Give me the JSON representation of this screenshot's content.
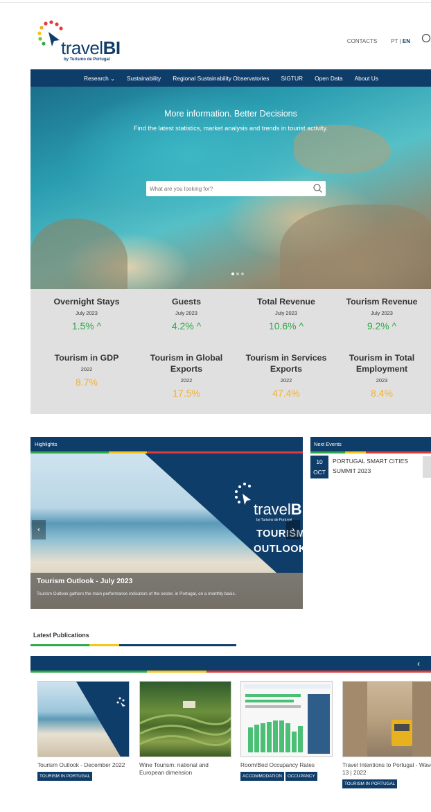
{
  "header": {
    "logo_word_light": "travel",
    "logo_word_bold": "BI",
    "logo_sub": "by Turismo de Portugal",
    "contacts": "CONTACTS",
    "lang_pt": "PT",
    "lang_sep": " | ",
    "lang_en": "EN"
  },
  "nav": {
    "items": [
      "Research",
      "Sustainability",
      "Regional Sustainability Observatories",
      "SIGTUR",
      "Open Data",
      "About Us"
    ],
    "caret": "⌄"
  },
  "hero": {
    "headline": "More information. Better Decisions",
    "tagline": "Find the latest statistics, market analysis and trends in tourist activity.",
    "search_placeholder": "What are you looking for?"
  },
  "kpis": [
    {
      "title": "Overnight Stays",
      "date": "July 2023",
      "value": "1.5% ^",
      "trend": "up"
    },
    {
      "title": "Guests",
      "date": "July 2023",
      "value": "4.2% ^",
      "trend": "up"
    },
    {
      "title": "Total Revenue",
      "date": "July 2023",
      "value": "10.6% ^",
      "trend": "up"
    },
    {
      "title": "Tourism Revenue",
      "date": "July 2023",
      "value": "9.2% ^",
      "trend": "up"
    },
    {
      "title": "Tourism in GDP",
      "date": "2022",
      "value": "8.7%",
      "trend": "none"
    },
    {
      "title": "Tourism in Global Exports",
      "date": "2022",
      "value": "17.5%",
      "trend": "none"
    },
    {
      "title": "Tourism in Services Exports",
      "date": "2022",
      "value": "47.4%",
      "trend": "none"
    },
    {
      "title": "Tourism in Total Employment",
      "date": "2023",
      "value": "8.4%",
      "trend": "none"
    }
  ],
  "colors": {
    "navy": "#0f3d6a",
    "green": "#2ea84a",
    "amber": "#f2b232",
    "red": "#e03a3a",
    "stripe_yellow": "#f5c518"
  },
  "highlights": {
    "label": "Highlights",
    "brand_light": "travel",
    "brand_bold": "BI",
    "brand_sub": "by Turismo de Portugal",
    "big_line1": "TOURISM",
    "big_line2": "OUTLOOK",
    "title": "Tourism Outlook - July 2023",
    "desc": "Tourism Outlook gathers the main performance indicators of the sector, in Portugal, on a monthly basis.",
    "prev": "‹",
    "next": "›"
  },
  "events": {
    "label": "Next Events",
    "day": "10",
    "month": "OCT",
    "title": "PORTUGAL SMART CITIES SUMMIT 2023"
  },
  "publications": {
    "label": "Latest Publications",
    "nav": "‹",
    "items": [
      {
        "title": "Tourism Outlook - December 2022",
        "badges": [
          "TOURISM IN PORTUGAL"
        ]
      },
      {
        "title": "Wine Tourism: national and European dimension",
        "badges": []
      },
      {
        "title": "Room/Bed Occupancy Rates",
        "badges": [
          "ACCOMMODATION",
          "OCCUPANCY"
        ]
      },
      {
        "title": "Travel Intentions to Portugal - Wave 13 | 2022",
        "badges": [
          "TOURISM IN PORTUGAL"
        ]
      }
    ]
  }
}
